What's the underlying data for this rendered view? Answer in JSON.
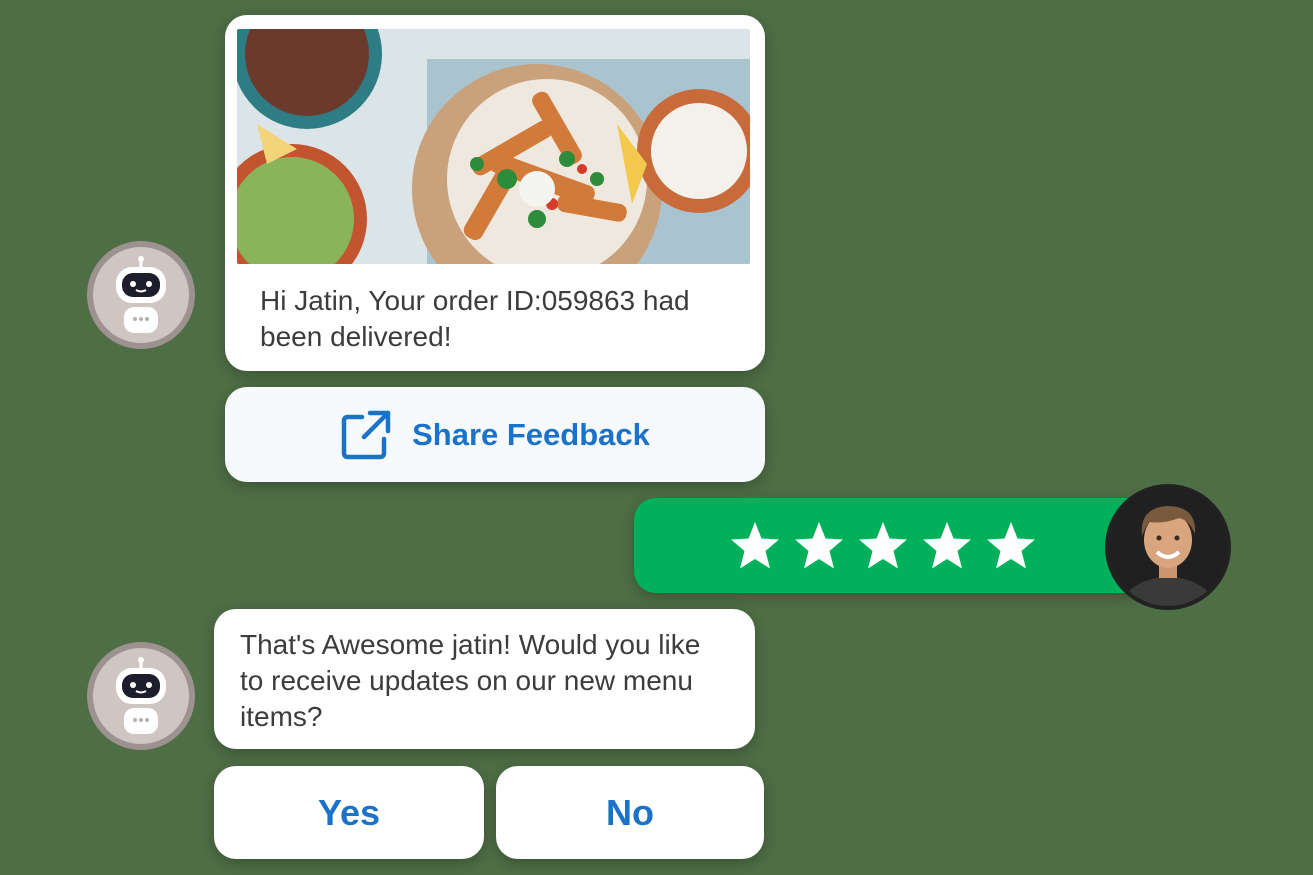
{
  "colors": {
    "background": "#4e6e45",
    "accent_blue": "#1a73c9",
    "rating_green": "#00b05a",
    "bubble": "#ffffff",
    "button": "#f7fafc"
  },
  "messages": {
    "order_delivered": "Hi Jatin, Your order ID:059863 had been delivered!",
    "share_feedback_label": "Share Feedback",
    "share_feedback_icon": "external-link-icon",
    "followup": "That's Awesome jatin! Would you like to receive updates on our new menu items?"
  },
  "rating": {
    "stars": 5,
    "max": 5,
    "icon": "star-icon"
  },
  "choices": {
    "yes_label": "Yes",
    "no_label": "No"
  },
  "avatars": {
    "bot_icon": "robot-icon",
    "user_icon": "user-avatar"
  },
  "image": {
    "icon": "food-photo"
  }
}
